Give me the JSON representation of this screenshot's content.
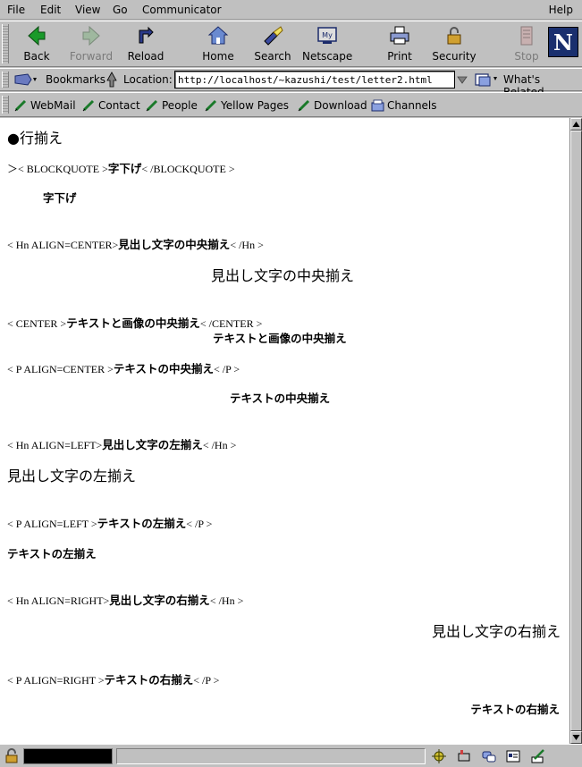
{
  "menu": {
    "items": [
      "File",
      "Edit",
      "View",
      "Go",
      "Communicator"
    ],
    "help": "Help"
  },
  "toolbar": {
    "back": "Back",
    "forward": "Forward",
    "reload": "Reload",
    "home": "Home",
    "search": "Search",
    "netscape": "Netscape",
    "print": "Print",
    "security": "Security",
    "stop": "Stop",
    "logo": "N"
  },
  "location": {
    "bookmarks": "Bookmarks",
    "label": "Location:",
    "url": "http://localhost/~kazushi/test/letter2.html",
    "related": "What's Related"
  },
  "personal": {
    "items": [
      "WebMail",
      "Contact",
      "People",
      "Yellow Pages",
      "Download",
      "Channels"
    ]
  },
  "page": {
    "heading": "●行揃え",
    "blockquote_tag_open": "＞< BLOCKQUOTE >",
    "blockquote_tag_text": "字下げ",
    "blockquote_tag_close": "< /BLOCKQUOTE >",
    "blockquote_demo": "字下げ",
    "hn_center_tag_open": "< Hn ALIGN=CENTER>",
    "hn_center_tag_text": "見出し文字の中央揃え",
    "hn_center_tag_close": "< /Hn >",
    "hn_center_demo": "見出し文字の中央揃え",
    "center_tag_open": "< CENTER >",
    "center_tag_text": "テキストと画像の中央揃え",
    "center_tag_close": "< /CENTER >",
    "center_demo": "テキストと画像の中央揃え",
    "p_center_tag_open": "< P ALIGN=CENTER >",
    "p_center_tag_text": "テキストの中央揃え",
    "p_center_tag_close": "< /P >",
    "p_center_demo": "テキストの中央揃え",
    "hn_left_tag_open": "< Hn ALIGN=LEFT>",
    "hn_left_tag_text": "見出し文字の左揃え",
    "hn_left_tag_close": "< /Hn >",
    "hn_left_demo": "見出し文字の左揃え",
    "p_left_tag_open": "< P ALIGN=LEFT >",
    "p_left_tag_text": "テキストの左揃え",
    "p_left_tag_close": "< /P >",
    "p_left_demo": "テキストの左揃え",
    "hn_right_tag_open": "< Hn ALIGN=RIGHT>",
    "hn_right_tag_text": "見出し文字の右揃え",
    "hn_right_tag_close": "< /Hn >",
    "hn_right_demo": "見出し文字の右揃え",
    "p_right_tag_open": "< P ALIGN=RIGHT >",
    "p_right_tag_text": "テキストの右揃え",
    "p_right_tag_close": "< /P >",
    "p_right_demo": "テキストの右揃え"
  },
  "colors": {
    "chrome": "#c0c0c0",
    "page_bg": "#ffffff",
    "logo_bg": "#1a2f6e"
  }
}
